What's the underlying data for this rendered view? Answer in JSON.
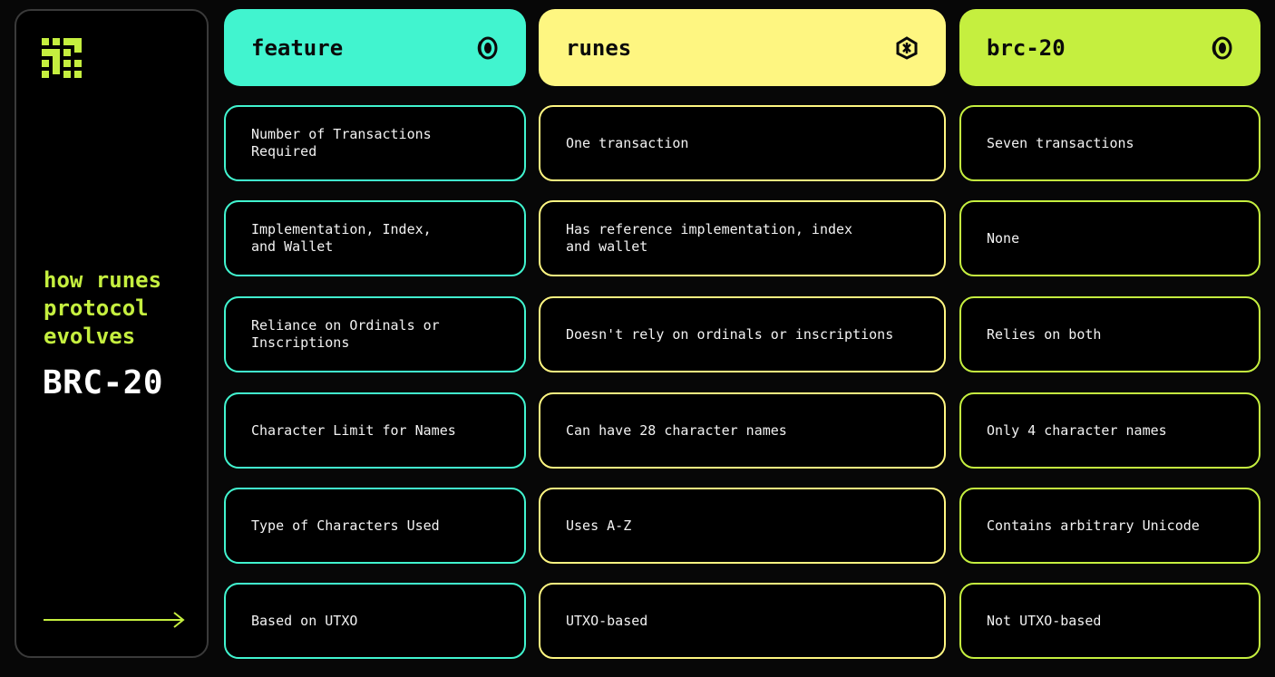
{
  "sidebar": {
    "tagline": "how runes\nprotocol\nevolves",
    "title": "BRC-20",
    "logo_icon": "pixel-logo-icon",
    "arrow_icon": "arrow-right-icon"
  },
  "colors": {
    "feature": "#41f4cf",
    "runes": "#fef681",
    "brc20": "#c5ef3f",
    "background": "#070707"
  },
  "columns": [
    {
      "key": "feature",
      "title": "feature",
      "icon": "coin-icon"
    },
    {
      "key": "runes",
      "title": "runes",
      "icon": "rune-coin-icon"
    },
    {
      "key": "brc20",
      "title": "brc-20",
      "icon": "coin-icon"
    }
  ],
  "rows": [
    {
      "feature": "Number of Transactions\nRequired",
      "runes": "One transaction",
      "brc20": "Seven transactions"
    },
    {
      "feature": "Implementation, Index,\nand Wallet",
      "runes": "Has reference implementation, index\nand wallet",
      "brc20": "None"
    },
    {
      "feature": "Reliance on Ordinals or\nInscriptions",
      "runes": "Doesn't rely on ordinals or inscriptions",
      "brc20": "Relies on both"
    },
    {
      "feature": "Character Limit for Names",
      "runes": "Can have 28 character names",
      "brc20": "Only 4 character names"
    },
    {
      "feature": "Type of Characters Used",
      "runes": "Uses A-Z",
      "brc20": "Contains arbitrary Unicode"
    },
    {
      "feature": "Based on UTXO",
      "runes": "UTXO-based",
      "brc20": "Not UTXO-based"
    }
  ]
}
